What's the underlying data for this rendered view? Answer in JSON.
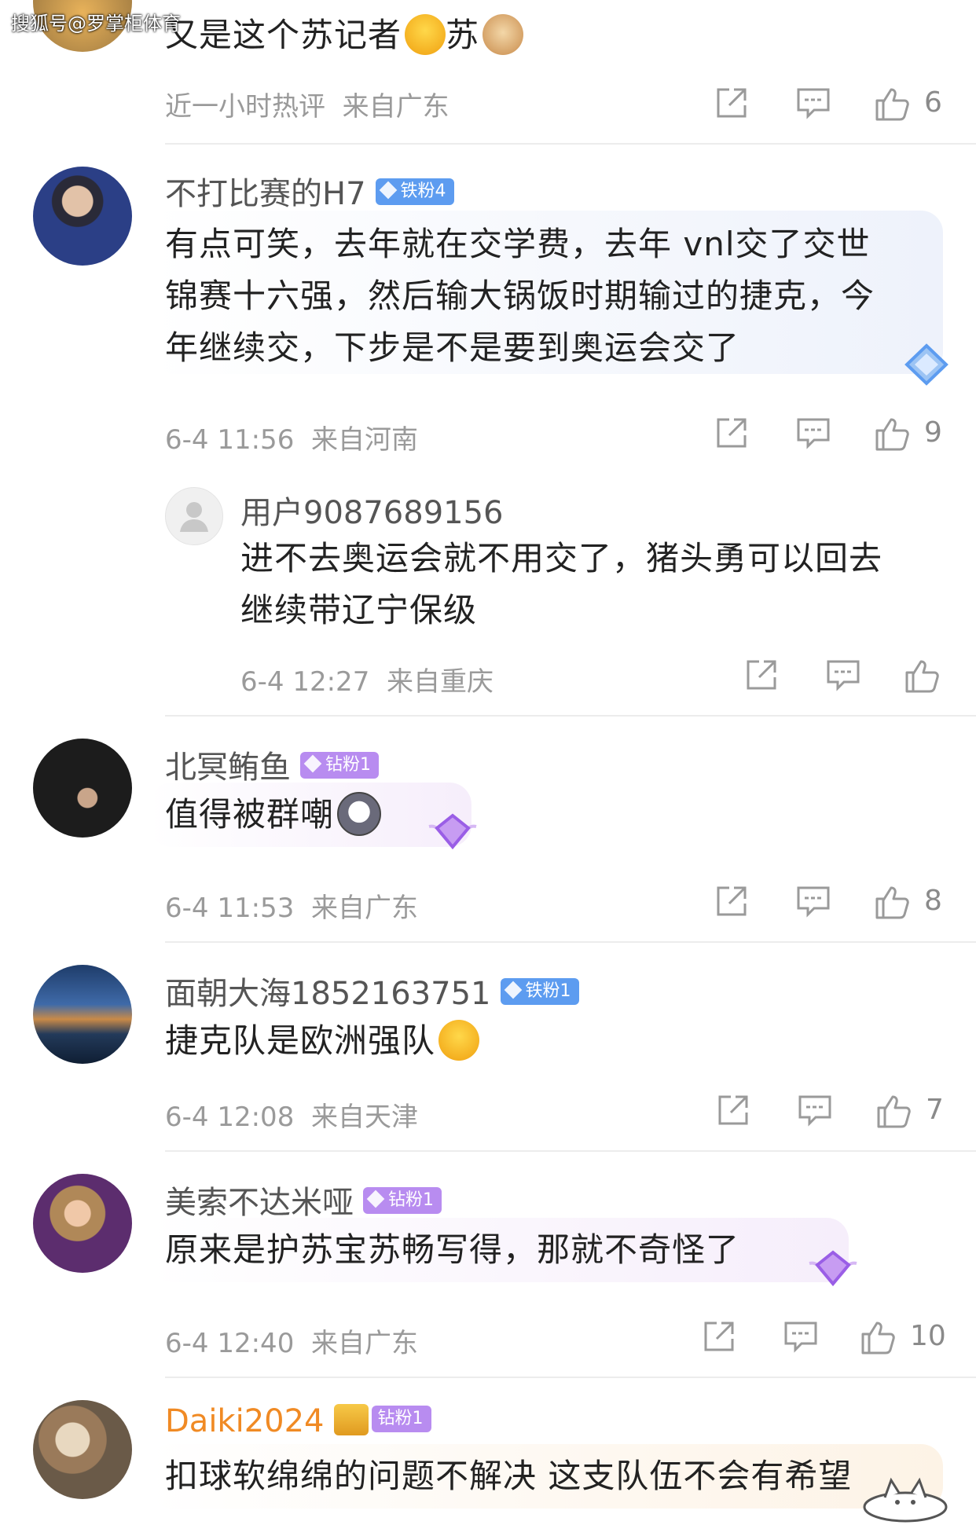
{
  "watermark": "搜狐号@罗掌柜体育",
  "comments": [
    {
      "name": "",
      "content": "又是这个苏记者",
      "content_suffix": "苏",
      "meta_time": "近一小时热评",
      "meta_loc": "来自广东",
      "likes": "6"
    },
    {
      "name": "不打比赛的H7",
      "badge": "铁粉4",
      "content_lines": [
        "有点可笑，去年就在交学费，去年 vnl交了交世",
        "锦赛十六强，然后输大锅饭时期输过的捷克，今",
        "年继续交，下步是不是要到奥运会交了"
      ],
      "meta_time": "6-4 11:56",
      "meta_loc": "来自河南",
      "likes": "9"
    },
    {
      "name": "用户9087689156",
      "content_lines": [
        "进不去奥运会就不用交了，猪头勇可以回去",
        "继续带辽宁保级"
      ],
      "meta_time": "6-4 12:27",
      "meta_loc": "来自重庆",
      "likes": ""
    },
    {
      "name": "北冥鲔鱼",
      "badge": "钻粉1",
      "content": "值得被群嘲",
      "meta_time": "6-4 11:53",
      "meta_loc": "来自广东",
      "likes": "8"
    },
    {
      "name": "面朝大海1852163751",
      "badge": "铁粉1",
      "content": "捷克队是欧洲强队",
      "meta_time": "6-4 12:08",
      "meta_loc": "来自天津",
      "likes": "7"
    },
    {
      "name": "美索不达米哑",
      "badge": "钻粉1",
      "content": "原来是护苏宝苏畅写得，那就不奇怪了",
      "meta_time": "6-4 12:40",
      "meta_loc": "来自广东",
      "likes": "10"
    },
    {
      "name": "Daiki2024",
      "badge": "钻粉1",
      "content": "扣球软绵绵的问题不解决 这支队伍不会有希望"
    }
  ],
  "icons": [
    "share-icon",
    "comment-icon",
    "like-icon"
  ],
  "colors": {
    "iron_badge": "#5d9cf0",
    "diamond_badge": "#b88cf0",
    "orange_name": "#f08a24",
    "meta_gray": "#9a9a9a"
  }
}
